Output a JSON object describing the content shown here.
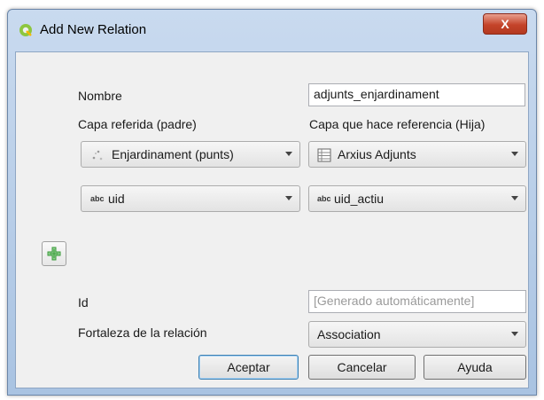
{
  "window": {
    "title": "Add New Relation",
    "close_glyph": "X"
  },
  "form": {
    "nombre_label": "Nombre",
    "nombre_value": "adjunts_enjardinament",
    "capa_referida_label": "Capa referida (padre)",
    "capa_hija_label": "Capa que hace referencia (Hija)",
    "capa_referida_value": "Enjardinament (punts)",
    "capa_hija_value": "Arxius Adjunts",
    "field_prefix": "abc",
    "campo_referido_value": "uid",
    "campo_hija_value": "uid_actiu",
    "id_label": "Id",
    "id_placeholder": "[Generado automáticamente]",
    "fortaleza_label": "Fortaleza de la relación",
    "fortaleza_value": "Association"
  },
  "buttons": {
    "accept": "Aceptar",
    "cancel": "Cancelar",
    "help": "Ayuda"
  },
  "icons": {
    "app": "qgis-logo-icon",
    "point_layer": "point-layer-icon",
    "table_layer": "table-layer-icon",
    "add": "green-plus-icon",
    "dropdown": "chevron-down-icon"
  },
  "colors": {
    "add_icon": "#3a9a3a",
    "title_bar": "#b9cfea",
    "close_button": "#c4432a"
  }
}
